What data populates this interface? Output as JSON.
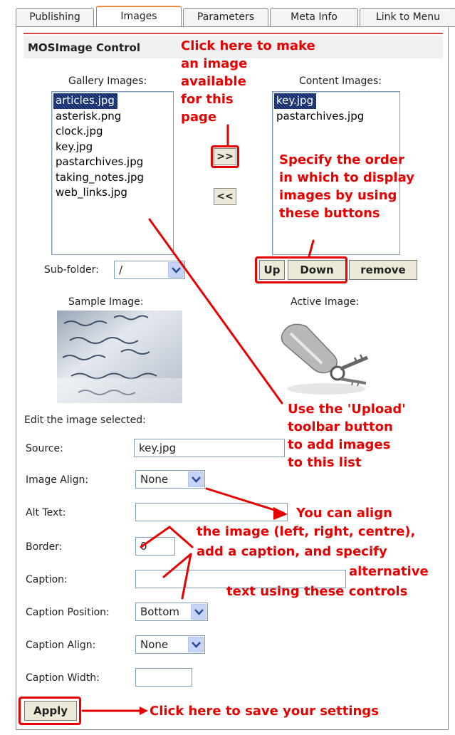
{
  "tabs": [
    {
      "label": "Publishing",
      "active": false
    },
    {
      "label": "Images",
      "active": true
    },
    {
      "label": "Parameters",
      "active": false
    },
    {
      "label": "Meta Info",
      "active": false
    },
    {
      "label": "Link to Menu",
      "active": false
    }
  ],
  "panel": {
    "title": "MOSImage Control"
  },
  "gallery": {
    "label": "Gallery Images:",
    "items": [
      "articles.jpg",
      "asterisk.png",
      "clock.jpg",
      "key.jpg",
      "pastarchives.jpg",
      "taking_notes.jpg",
      "web_links.jpg"
    ],
    "selected": "articles.jpg"
  },
  "content": {
    "label": "Content Images:",
    "items": [
      "key.jpg",
      "pastarchives.jpg"
    ],
    "selected": "key.jpg"
  },
  "move": {
    "add_label": ">>",
    "remove_label": "<<"
  },
  "order": {
    "up_label": "Up",
    "down_label": "Down",
    "remove_label": "remove"
  },
  "subfolder": {
    "label": "Sub-folder:",
    "value": "/"
  },
  "sample": {
    "label": "Sample Image:"
  },
  "active": {
    "label": "Active Image:"
  },
  "edit": {
    "heading": "Edit the image selected:",
    "source_label": "Source:",
    "source_value": "key.jpg",
    "align_label": "Image Align:",
    "align_value": "None",
    "alt_label": "Alt Text:",
    "alt_value": "",
    "border_label": "Border:",
    "border_value": "0",
    "caption_label": "Caption:",
    "caption_value": "",
    "caption_position_label": "Caption Position:",
    "caption_position_value": "Bottom",
    "caption_align_label": "Caption Align:",
    "caption_align_value": "None",
    "caption_width_label": "Caption Width:",
    "caption_width_value": ""
  },
  "apply": {
    "label": "Apply"
  },
  "annotations": {
    "make_available": [
      "Click here to make",
      "an image",
      "available",
      "for this",
      "page"
    ],
    "order": [
      "Specify the order",
      "in which to display",
      "images by using",
      "these buttons"
    ],
    "upload": [
      "Use the 'Upload'",
      "toolbar button",
      "to add images",
      "to this list"
    ],
    "align": [
      "You can align",
      "the image (left, right, centre),",
      "add a caption, and specify",
      "alternative",
      "text using these controls"
    ],
    "save": "Click here to save your settings"
  },
  "colors": {
    "annotation_red": "#e60000",
    "selection_blue": "#0a246a",
    "tab_accent": "#f08a3e",
    "button_face": "#ece9d8"
  }
}
